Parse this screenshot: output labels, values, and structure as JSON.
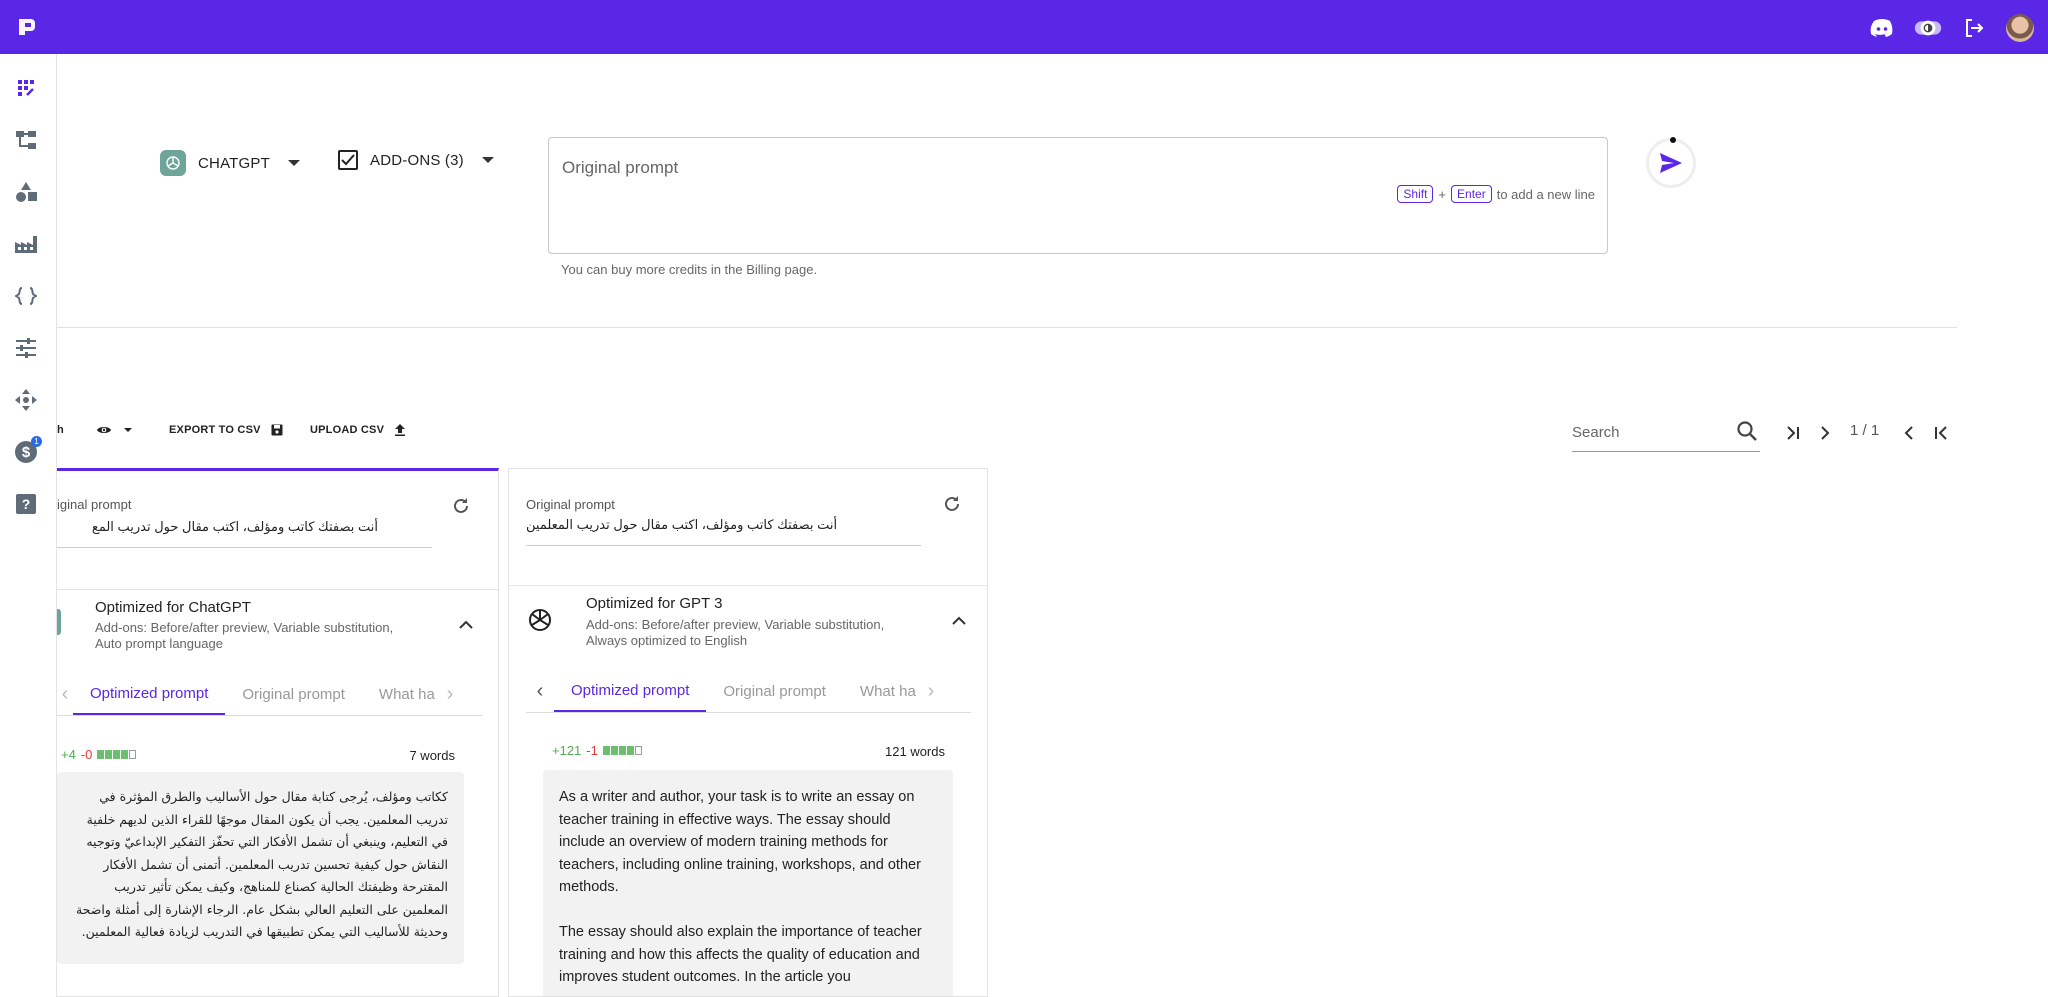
{
  "app": {
    "logo": "app-logo-icon"
  },
  "topbar": {
    "icons": [
      "discord-icon",
      "theme-toggle-icon",
      "logout-icon",
      "avatar"
    ]
  },
  "sidebar": {
    "items": [
      "grid-icon",
      "tree-icon",
      "shapes-icon",
      "factory-icon",
      "braces-icon",
      "sliders-icon",
      "move-icon",
      "dollar-icon",
      "help-icon"
    ],
    "badge": "1"
  },
  "model_selector": {
    "label": "CHATGPT"
  },
  "addons_selector": {
    "label": "ADD-ONS (3)"
  },
  "prompt": {
    "placeholder": "Original prompt",
    "hint_shift": "Shift",
    "hint_plus": "+",
    "hint_enter": "Enter",
    "hint_text": "to add a new line",
    "credits_note": "You can buy more credits in the Billing page."
  },
  "toolbar": {
    "partial_label": "h",
    "export_label": "EXPORT TO CSV",
    "upload_label": "UPLOAD CSV",
    "search_placeholder": "Search",
    "page_indicator": "1 / 1"
  },
  "cards": [
    {
      "orig_label": "iginal prompt",
      "orig_text": "أنت بصفتك كاتب ومؤلف، اكتب مقال حول تدريب المع",
      "opt_title": "Optimized for ChatGPT",
      "opt_addons_1": "Add-ons: Before/after preview, Variable substitution,",
      "opt_addons_2": "Auto prompt language",
      "tabs": [
        "Optimized prompt",
        "Original prompt",
        "What ha"
      ],
      "plus": "+4",
      "minus": "-0",
      "bar_filled": 4,
      "bar_total": 5,
      "words": "7 words",
      "output": "ككاتب ومؤلف، يُرجى كتابة مقال حول الأساليب والطرق المؤثرة في تدريب المعلمين. يجب أن يكون المقال موجهًا للقراء الذين لديهم خلفية في التعليم، وينبغي أن تشمل الأفكار التي تحفّز التفكير الإبداعيّ وتوجيه النقاش حول كيفية تحسين تدريب المعلمين. أتمنى أن تشمل الأفكار المقترحة وظيفتك الحالية كصناع للمناهج، وكيف يمكن تأثير تدريب المعلمين على التعليم العالي بشكل عام. الرجاء الإشارة إلى أمثلة واضحة وحديثة للأساليب التي يمكن تطبيقها في التدريب لزيادة فعالية المعلمين."
    },
    {
      "orig_label": "Original prompt",
      "orig_text": "أنت بصفتك كاتب ومؤلف، اكتب مقال حول تدريب المعلمين",
      "opt_title": "Optimized for GPT 3",
      "opt_addons_1": "Add-ons: Before/after preview, Variable substitution,",
      "opt_addons_2": "Always optimized to English",
      "tabs": [
        "Optimized prompt",
        "Original prompt",
        "What ha"
      ],
      "plus": "+121",
      "minus": "-1",
      "bar_filled": 4,
      "bar_total": 5,
      "words": "121 words",
      "output": "As a writer and author, your task is to write an essay on teacher training in effective ways. The essay should include an overview of modern training methods for teachers, including online training, workshops, and other methods.\n\nThe essay should also explain the importance of teacher training and how this affects the quality of education and improves student outcomes. In the article you"
    }
  ]
}
